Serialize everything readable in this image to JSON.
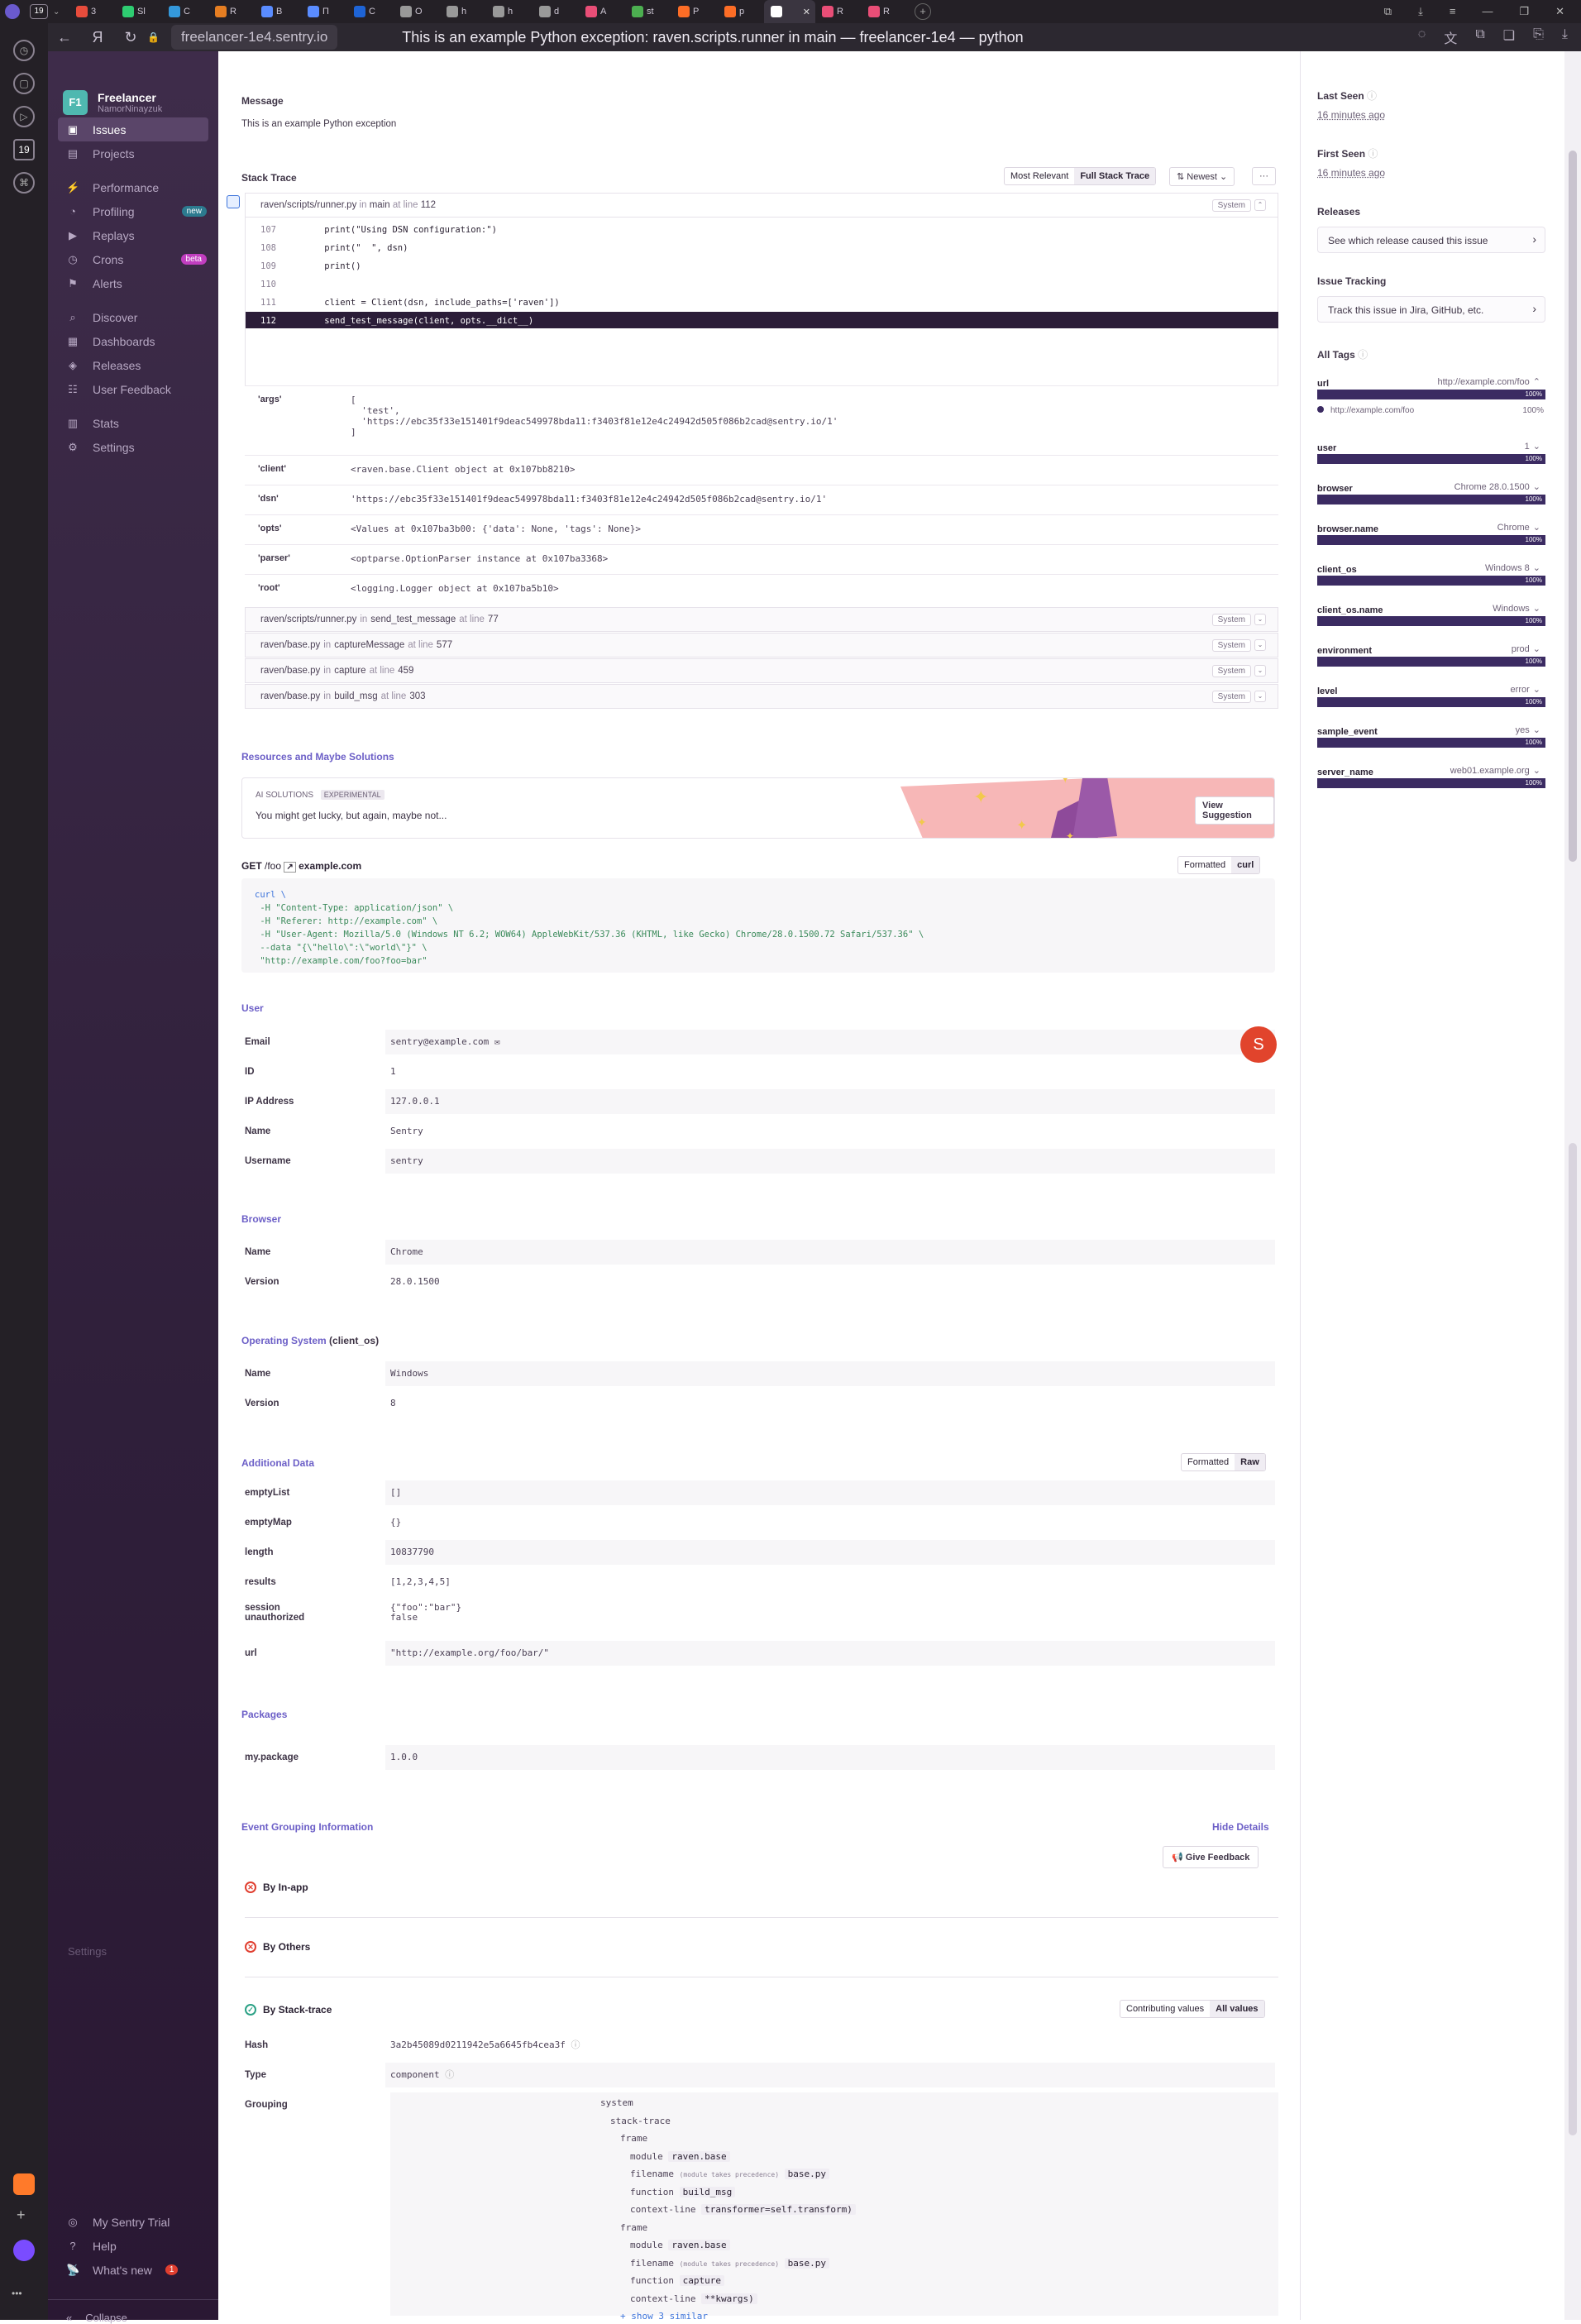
{
  "browser": {
    "tab_count": "19",
    "tabs": [
      "3",
      "Sl",
      "C",
      "R",
      "B",
      "П",
      "С",
      "O",
      "h",
      "h",
      "d",
      "A",
      "st",
      "P",
      "p",
      "",
      "R",
      "R"
    ],
    "url": "freelancer-1e4.sentry.io",
    "page_title": "This is an example Python exception: raven.scripts.runner in main — freelancer-1e4 — python",
    "side_badge": "19"
  },
  "nav": {
    "org_badge": "F1",
    "org_name": "Freelancer",
    "org_user": "NamorNinayzuk",
    "items": [
      {
        "label": "Issues",
        "icon": "issues-icon"
      },
      {
        "label": "Projects",
        "icon": "projects-icon"
      },
      {
        "label": "Performance",
        "icon": "performance-icon"
      },
      {
        "label": "Profiling",
        "icon": "profiling-icon",
        "badge": "new"
      },
      {
        "label": "Replays",
        "icon": "replays-icon"
      },
      {
        "label": "Crons",
        "icon": "crons-icon",
        "badge": "beta"
      },
      {
        "label": "Alerts",
        "icon": "alerts-icon"
      },
      {
        "label": "Discover",
        "icon": "discover-icon"
      },
      {
        "label": "Dashboards",
        "icon": "dashboards-icon"
      },
      {
        "label": "Releases",
        "icon": "releases-icon"
      },
      {
        "label": "User Feedback",
        "icon": "feedback-icon"
      },
      {
        "label": "Stats",
        "icon": "stats-icon"
      },
      {
        "label": "Settings",
        "icon": "settings-icon"
      }
    ],
    "ghost_settings": "Settings",
    "bottom": [
      {
        "label": "My Sentry Trial"
      },
      {
        "label": "Help"
      },
      {
        "label": "What's new",
        "count": "1"
      }
    ],
    "collapse": "Collapse"
  },
  "message": {
    "heading": "Message",
    "text": "This is an example Python exception"
  },
  "stack": {
    "heading": "Stack Trace",
    "btn_most_relevant": "Most Relevant",
    "btn_full": "Full Stack Trace",
    "btn_sort": "Newest",
    "btn_more": "···",
    "frame_top": {
      "file": "raven/scripts/runner.py",
      "in": "in",
      "func": "main",
      "at": "at line",
      "line": "112",
      "tag": "System"
    },
    "code_lines": [
      {
        "no": "107",
        "code": "    print(\"Using DSN configuration:\")"
      },
      {
        "no": "108",
        "code": "    print(\"  \", dsn)"
      },
      {
        "no": "109",
        "code": "    print()"
      },
      {
        "no": "110",
        "code": ""
      },
      {
        "no": "111",
        "code": "    client = Client(dsn, include_paths=['raven'])"
      },
      {
        "no": "112",
        "code": "    send_test_message(client, opts.__dict__)"
      }
    ],
    "vars": [
      {
        "k": "'args'",
        "v": "[\n  'test',\n  'https://ebc35f33e151401f9deac549978bda11:f3403f81e12e4c24942d505f086b2cad@sentry.io/1'\n]"
      },
      {
        "k": "'client'",
        "v": "<raven.base.Client object at 0x107bb8210>"
      },
      {
        "k": "'dsn'",
        "v": "'https://ebc35f33e151401f9deac549978bda11:f3403f81e12e4c24942d505f086b2cad@sentry.io/1'"
      },
      {
        "k": "'opts'",
        "v": "<Values at 0x107ba3b00: {'data': None, 'tags': None}>"
      },
      {
        "k": "'parser'",
        "v": "<optparse.OptionParser instance at 0x107ba3368>"
      },
      {
        "k": "'root'",
        "v": "<logging.Logger object at 0x107ba5b10>"
      }
    ],
    "frames": [
      {
        "file": "raven/scripts/runner.py",
        "in": "in",
        "func": "send_test_message",
        "at": "at line",
        "line": "77",
        "tag": "System"
      },
      {
        "file": "raven/base.py",
        "in": "in",
        "func": "captureMessage",
        "at": "at line",
        "line": "577",
        "tag": "System"
      },
      {
        "file": "raven/base.py",
        "in": "in",
        "func": "capture",
        "at": "at line",
        "line": "459",
        "tag": "System"
      },
      {
        "file": "raven/base.py",
        "in": "in",
        "func": "build_msg",
        "at": "at line",
        "line": "303",
        "tag": "System"
      }
    ]
  },
  "resources": {
    "heading": "Resources and Maybe Solutions",
    "ai_label": "AI SOLUTIONS",
    "experimental": "EXPERIMENTAL",
    "text": "You might get lucky, but again, maybe not...",
    "button": "View Suggestion"
  },
  "request": {
    "method": "GET",
    "path": "/foo",
    "host": "example.com",
    "btn_formatted": "Formatted",
    "btn_curl": "curl",
    "curl_lines": [
      "curl \\",
      " -H \"Content-Type: application/json\" \\",
      " -H \"Referer: http://example.com\" \\",
      " -H \"User-Agent: Mozilla/5.0 (Windows NT 6.2; WOW64) AppleWebKit/537.36 (KHTML, like Gecko) Chrome/28.0.1500.72 Safari/537.36\" \\",
      " --data \"{\\\"hello\\\":\\\"world\\\"}\" \\",
      " \"http://example.com/foo?foo=bar\""
    ]
  },
  "user": {
    "heading": "User",
    "avatar": "S",
    "rows": [
      {
        "k": "Email",
        "v": "sentry@example.com ✉"
      },
      {
        "k": "ID",
        "v": "1"
      },
      {
        "k": "IP Address",
        "v": "127.0.0.1"
      },
      {
        "k": "Name",
        "v": "Sentry"
      },
      {
        "k": "Username",
        "v": "sentry"
      }
    ]
  },
  "browser_ctx": {
    "heading": "Browser",
    "rows": [
      {
        "k": "Name",
        "v": "Chrome"
      },
      {
        "k": "Version",
        "v": "28.0.1500"
      }
    ]
  },
  "os_ctx": {
    "heading": "Operating System",
    "heading_suffix": "(client_os)",
    "rows": [
      {
        "k": "Name",
        "v": "Windows"
      },
      {
        "k": "Version",
        "v": "8"
      }
    ]
  },
  "additional": {
    "heading": "Additional Data",
    "btn_formatted": "Formatted",
    "btn_raw": "Raw",
    "rows": [
      {
        "k": "emptyList",
        "v": "[]"
      },
      {
        "k": "emptyMap",
        "v": "{}"
      },
      {
        "k": "length",
        "v": "10837790"
      },
      {
        "k": "results",
        "v": "[1,2,3,4,5]"
      },
      {
        "k": "session",
        "v": "{\"foo\":\"bar\"}"
      },
      {
        "k": "unauthorized",
        "v": "false"
      },
      {
        "k": "url",
        "v": "\"http://example.org/foo/bar/\""
      }
    ]
  },
  "packages": {
    "heading": "Packages",
    "rows": [
      {
        "k": "my.package",
        "v": "1.0.0"
      }
    ]
  },
  "grouping": {
    "heading": "Event Grouping Information",
    "hide": "Hide Details",
    "feedback": "Give Feedback",
    "by_inapp": "By In-app",
    "by_others": "By Others",
    "by_stack": "By Stack-trace",
    "btn_contrib": "Contributing values",
    "btn_all": "All values",
    "hash_k": "Hash",
    "hash_v": "3a2b45089d0211942e5a6645fb4cea3f",
    "type_k": "Type",
    "type_v": "component",
    "grouping_k": "Grouping",
    "tree": [
      {
        "indent": 0,
        "t": "system"
      },
      {
        "indent": 1,
        "t": "stack-trace"
      },
      {
        "indent": 2,
        "t": "frame"
      },
      {
        "indent": 3,
        "t": "module",
        "chip": "raven.base"
      },
      {
        "indent": 3,
        "t": "filename",
        "small": "(module takes precedence)",
        "chip": "base.py"
      },
      {
        "indent": 3,
        "t": "function",
        "chip": "build_msg"
      },
      {
        "indent": 3,
        "t": "context-line",
        "chip": "transformer=self.transform)"
      },
      {
        "indent": 2,
        "t": "frame"
      },
      {
        "indent": 3,
        "t": "module",
        "chip": "raven.base"
      },
      {
        "indent": 3,
        "t": "filename",
        "small": "(module takes precedence)",
        "chip": "base.py"
      },
      {
        "indent": 3,
        "t": "function",
        "chip": "capture"
      },
      {
        "indent": 3,
        "t": "context-line",
        "chip": "**kwargs)"
      },
      {
        "indent": 2,
        "t": "+ show 3 similar",
        "link": true
      }
    ]
  },
  "sidebar": {
    "last_seen_h": "Last Seen",
    "last_seen_v": "16 minutes ago",
    "first_seen_h": "First Seen",
    "first_seen_v": "16 minutes ago",
    "releases_h": "Releases",
    "releases_btn": "See which release caused this issue",
    "tracking_h": "Issue Tracking",
    "tracking_btn": "Track this issue in Jira, GitHub, etc.",
    "tags_h": "All Tags",
    "url_expanded_value": "http://example.com/foo",
    "url_expanded_pct": "100%",
    "tags": [
      {
        "k": "url",
        "v": "http://example.com/foo",
        "pct": "100%",
        "fill": 1.0
      },
      {
        "k": "user",
        "v": "1",
        "pct": "100%",
        "fill": 1.0
      },
      {
        "k": "browser",
        "v": "Chrome 28.0.1500",
        "pct": "100%",
        "fill": 1.0
      },
      {
        "k": "browser.name",
        "v": "Chrome",
        "pct": "100%",
        "fill": 1.0
      },
      {
        "k": "client_os",
        "v": "Windows 8",
        "pct": "100%",
        "fill": 1.0
      },
      {
        "k": "client_os.name",
        "v": "Windows",
        "pct": "100%",
        "fill": 1.0
      },
      {
        "k": "environment",
        "v": "prod",
        "pct": "100%",
        "fill": 1.0
      },
      {
        "k": "level",
        "v": "error",
        "pct": "100%",
        "fill": 1.0
      },
      {
        "k": "sample_event",
        "v": "yes",
        "pct": "100%",
        "fill": 1.0
      },
      {
        "k": "server_name",
        "v": "web01.example.org",
        "pct": "100%",
        "fill": 1.0
      }
    ]
  }
}
